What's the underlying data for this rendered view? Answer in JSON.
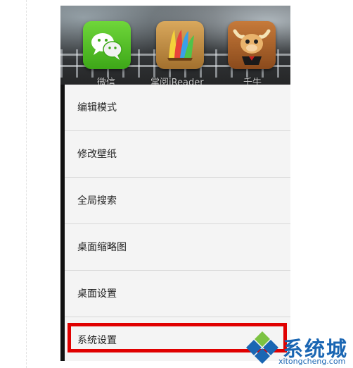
{
  "home_screen": {
    "apps": [
      {
        "name": "微信",
        "icon": "wechat-icon"
      },
      {
        "name": "掌阅iReader",
        "icon": "ireader-icon"
      },
      {
        "name": "千牛",
        "icon": "qianniu-icon"
      }
    ]
  },
  "menu": {
    "items": [
      {
        "label": "编辑模式"
      },
      {
        "label": "修改壁纸"
      },
      {
        "label": "全局搜索"
      },
      {
        "label": "桌面缩略图"
      },
      {
        "label": "桌面设置"
      },
      {
        "label": "系统设置",
        "highlighted": true
      }
    ]
  },
  "highlight_color": "#e00000",
  "watermark": {
    "text": "系统城",
    "url": "xitongcheng.com",
    "logo": "diamond-logo-icon",
    "color": "#1a66b3"
  }
}
